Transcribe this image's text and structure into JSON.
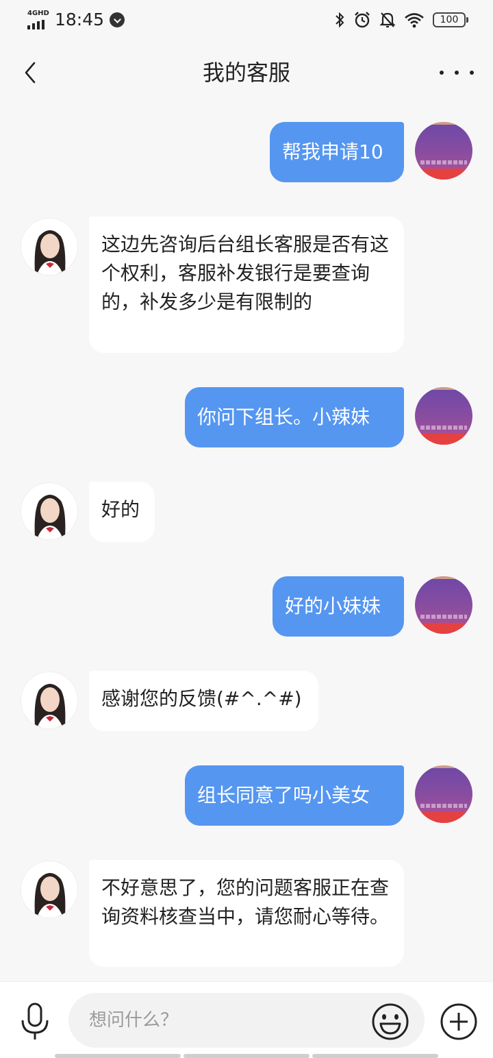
{
  "status_bar": {
    "network": "4GHD",
    "time": "18:45",
    "battery": "100",
    "icons": [
      "bluetooth-icon",
      "alarm-icon",
      "mute-icon",
      "wifi-icon"
    ]
  },
  "nav": {
    "title": "我的客服",
    "back_icon": "chevron-left-icon",
    "more_icon": "more-icon"
  },
  "messages": [
    {
      "from": "user",
      "text": "帮我申请10"
    },
    {
      "from": "agent",
      "text": "这边先咨询后台组长客服是否有这个权利，客服补发银行是要查询的，补发多少是有限制的"
    },
    {
      "from": "user",
      "text": "你问下组长。小辣妹"
    },
    {
      "from": "agent",
      "text": "好的"
    },
    {
      "from": "user",
      "text": "好的小妹妹"
    },
    {
      "from": "agent",
      "text": "感谢您的反馈(#^.^#)"
    },
    {
      "from": "user",
      "text": "组长同意了吗小美女"
    },
    {
      "from": "agent",
      "text": "不好意思了，您的问题客服正在查询资料核查当中，请您耐心等待。"
    }
  ],
  "input": {
    "placeholder": "想问什么？"
  },
  "colors": {
    "user_bubble": "#5596f0",
    "agent_bubble": "#ffffff",
    "background": "#f7f7f7"
  }
}
